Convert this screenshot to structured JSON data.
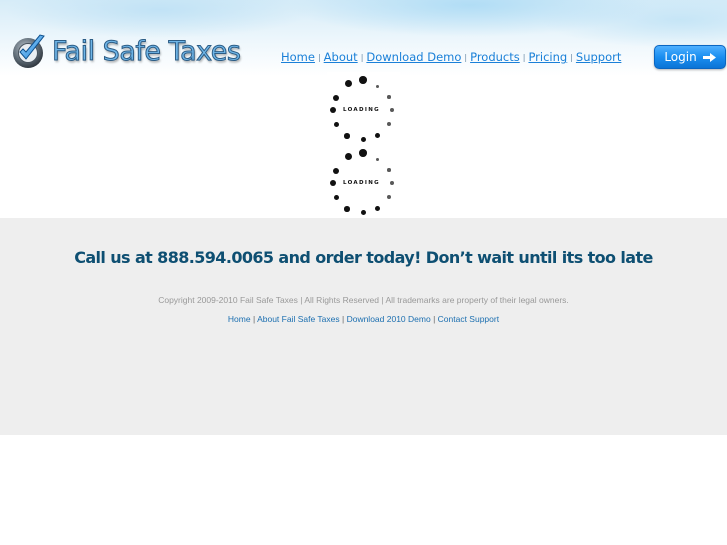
{
  "brand": {
    "name": "Fail Safe Taxes",
    "logo_icon": "checkmark-badge-icon"
  },
  "nav": {
    "items": [
      {
        "label": "Home"
      },
      {
        "label": "About"
      },
      {
        "label": "Download Demo"
      },
      {
        "label": "Products"
      },
      {
        "label": "Pricing"
      },
      {
        "label": "Support"
      }
    ],
    "separator": "|"
  },
  "login": {
    "label": "Login",
    "icon": "arrow-right-icon"
  },
  "loaders": [
    {
      "label": "LOADING"
    },
    {
      "label": "LOADING"
    }
  ],
  "footer": {
    "cta": "Call us at 888.594.0065 and order today! Don’t wait until its too late",
    "copyright": "Copyright 2009-2010 Fail Safe Taxes | All Rights Reserved | All trademarks are property of their legal owners.",
    "links": [
      {
        "label": "Home"
      },
      {
        "label": "About Fail Safe Taxes"
      },
      {
        "label": "Download 2010 Demo"
      },
      {
        "label": "Contact Support"
      }
    ],
    "separator": "|"
  },
  "colors": {
    "nav_link": "#1a80d8",
    "cta": "#0e4f72",
    "login_bg": "#1b8ef0",
    "footer_bg": "#eeeeee"
  }
}
